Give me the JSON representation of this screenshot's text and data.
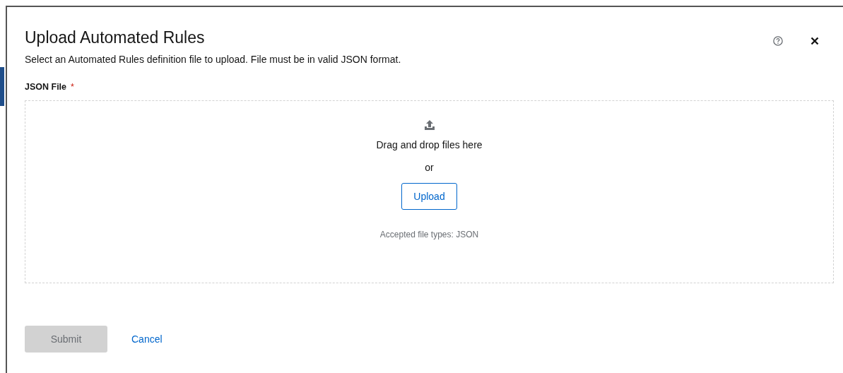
{
  "modal": {
    "title": "Upload Automated Rules",
    "description": "Select an Automated Rules definition file to upload. File must be in valid JSON format.",
    "field": {
      "label": "JSON File",
      "required": true,
      "required_mark": "*"
    },
    "dropzone": {
      "prompt": "Drag and drop files here",
      "separator": "or",
      "button": "Upload",
      "hint": "Accepted file types: JSON"
    },
    "actions": [
      {
        "kind": "primary",
        "label": "Submit",
        "disabled": true
      },
      {
        "kind": "link",
        "label": "Cancel",
        "disabled": false
      }
    ]
  }
}
